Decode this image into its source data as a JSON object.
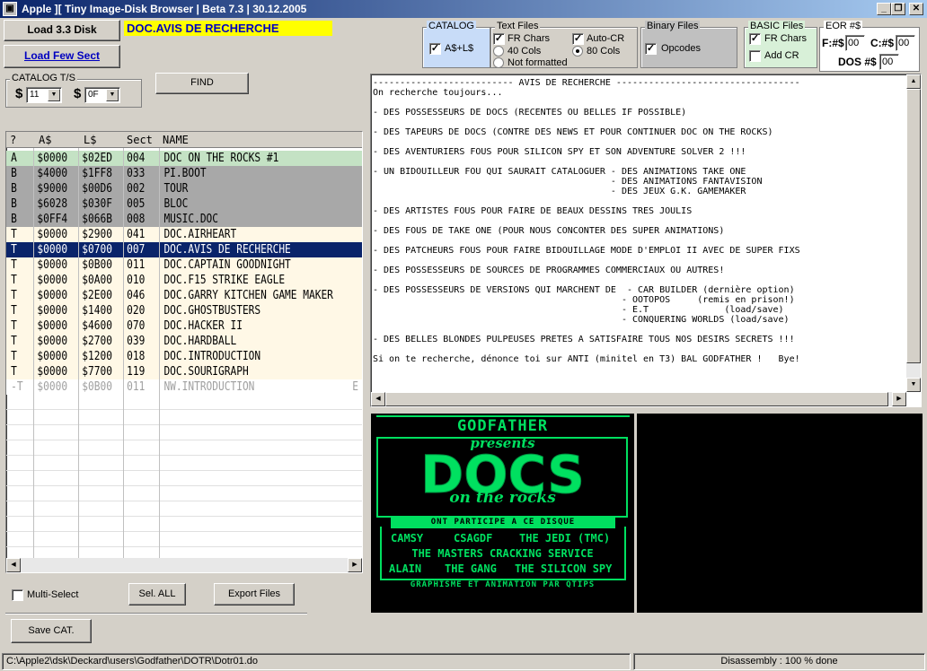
{
  "window": {
    "title": "Apple ][ Tiny Image-Disk Browser | Beta 7.3 | 30.12.2005",
    "controls": [
      "_",
      "❐",
      "✕"
    ]
  },
  "toolbar": {
    "load_disk": "Load 3.3 Disk",
    "load_few_sect": "Load Few Sect",
    "current_file": "DOC.AVIS DE RECHERCHE"
  },
  "catalog_group": {
    "label": "CATALOG",
    "option": "A$+L$",
    "checked": true
  },
  "text_files": {
    "label": "Text Files",
    "fr_chars": "FR Chars",
    "fr_chars_checked": true,
    "auto_cr": "Auto-CR",
    "auto_cr_checked": true,
    "cols40": "40 Cols",
    "cols80": "80 Cols",
    "cols_selected": "80",
    "not_formatted": "Not formatted"
  },
  "binary_files": {
    "label": "Binary Files",
    "opcodes": "Opcodes",
    "opcodes_checked": true
  },
  "basic_files": {
    "label": "BASIC Files",
    "fr_chars": "FR Chars",
    "fr_chars_checked": true,
    "add_cr": "Add CR",
    "add_cr_checked": false
  },
  "eor": {
    "label": "EOR #$",
    "f_label": "F:#$",
    "f_value": "00",
    "c_label": "C:#$",
    "c_value": "00",
    "dos_label": "DOS #$",
    "dos_value": "00"
  },
  "catalog_ts": {
    "label": "CATALOG T/S",
    "track_prefix": "$",
    "track": "11",
    "sector_prefix": "$",
    "sector": "0F"
  },
  "find_button": "FIND",
  "table": {
    "headers": [
      "?",
      "A$",
      "L$",
      "Sect",
      "NAME"
    ],
    "rows": [
      {
        "t": "A",
        "a": "$0000",
        "l": "$02ED",
        "s": "004",
        "n": "DOC ON THE ROCKS #1",
        "style": "a"
      },
      {
        "t": "B",
        "a": "$4000",
        "l": "$1FF8",
        "s": "033",
        "n": "PI.BOOT",
        "style": "b"
      },
      {
        "t": "B",
        "a": "$9000",
        "l": "$00D6",
        "s": "002",
        "n": "TOUR",
        "style": "b"
      },
      {
        "t": "B",
        "a": "$6028",
        "l": "$030F",
        "s": "005",
        "n": "BLOC",
        "style": "b"
      },
      {
        "t": "B",
        "a": "$0FF4",
        "l": "$066B",
        "s": "008",
        "n": "MUSIC.DOC",
        "style": "b"
      },
      {
        "t": "T",
        "a": "$0000",
        "l": "$2900",
        "s": "041",
        "n": "DOC.AIRHEART",
        "style": "t"
      },
      {
        "t": "T",
        "a": "$0000",
        "l": "$0700",
        "s": "007",
        "n": "DOC.AVIS DE RECHERCHE",
        "style": "sel"
      },
      {
        "t": "T",
        "a": "$0000",
        "l": "$0B00",
        "s": "011",
        "n": "DOC.CAPTAIN GOODNIGHT",
        "style": "t"
      },
      {
        "t": "T",
        "a": "$0000",
        "l": "$0A00",
        "s": "010",
        "n": "DOC.F15 STRIKE EAGLE",
        "style": "t"
      },
      {
        "t": "T",
        "a": "$0000",
        "l": "$2E00",
        "s": "046",
        "n": "DOC.GARRY KITCHEN GAME MAKER",
        "style": "t"
      },
      {
        "t": "T",
        "a": "$0000",
        "l": "$1400",
        "s": "020",
        "n": "DOC.GHOSTBUSTERS",
        "style": "t"
      },
      {
        "t": "T",
        "a": "$0000",
        "l": "$4600",
        "s": "070",
        "n": "DOC.HACKER II",
        "style": "t"
      },
      {
        "t": "T",
        "a": "$0000",
        "l": "$2700",
        "s": "039",
        "n": "DOC.HARDBALL",
        "style": "t"
      },
      {
        "t": "T",
        "a": "$0000",
        "l": "$1200",
        "s": "018",
        "n": "DOC.INTRODUCTION",
        "style": "t"
      },
      {
        "t": "T",
        "a": "$0000",
        "l": "$7700",
        "s": "119",
        "n": "DOC.SOURIGRAPH",
        "style": "t"
      },
      {
        "t": "-T",
        "a": "$0000",
        "l": "$0B00",
        "s": "011",
        "n": "NW.INTRODUCTION",
        "style": "del",
        "e": "E"
      }
    ]
  },
  "bottom": {
    "multi_select": "Multi-Select",
    "sel_all": "Sel. ALL",
    "export_files": "Export Files",
    "save_cat": "Save CAT."
  },
  "text_lines": [
    "-------------------------- AVIS DE RECHERCHE ----------------------------------",
    "On recherche toujours...",
    "",
    "- DES POSSESSEURS DE DOCS (RECENTES OU BELLES IF POSSIBLE)",
    "",
    "- DES TAPEURS DE DOCS (CONTRE DES NEWS ET POUR CONTINUER DOC ON THE ROCKS)",
    "",
    "- DES AVENTURIERS FOUS POUR SILICON SPY ET SON ADVENTURE SOLVER 2 !!!",
    "",
    "- UN BIDOUILLEUR FOU QUI SAURAIT CATALOGUER - DES ANIMATIONS TAKE ONE",
    "                                            - DES ANIMATIONS FANTAVISION",
    "                                            - DES JEUX G.K. GAMEMAKER",
    "",
    "- DES ARTISTES FOUS POUR FAIRE DE BEAUX DESSINS TRES JOULIS",
    "",
    "- DES FOUS DE TAKE ONE (POUR NOUS CONCONTER DES SUPER ANIMATIONS)",
    "",
    "- DES PATCHEURS FOUS POUR FAIRE BIDOUILLAGE MODE D'EMPLOI II AVEC DE SUPER FIXS",
    "",
    "- DES POSSESSEURS DE SOURCES DE PROGRAMMES COMMERCIAUX OU AUTRES!",
    "",
    "- DES POSSESSEURS DE VERSIONS QUI MARCHENT DE  - CAR BUILDER (dernière option)",
    "                                              - OOTOPOS     (remis en prison!)",
    "                                              - E.T              (load/save)",
    "                                              - CONQUERING WORLDS (load/save)",
    "",
    "- DES BELLES BLONDES PULPEUSES PRETES A SATISFAIRE TOUS NOS DESIRS SECRETS !!!",
    "",
    "Si on te recherche, dénonce toi sur ANTI (minitel en T3) BAL GODFATHER !   Bye!"
  ],
  "graphic": {
    "title1": "GODFATHER",
    "title2": "presents",
    "logo": "DOCS",
    "subtitle": "on the rocks",
    "banner": "ONT PARTICIPE A CE DISQUE",
    "credits": [
      [
        "CAMSY",
        "CSAGDF",
        "THE JEDI (TMC)"
      ],
      [
        "THE MASTERS CRACKING SERVICE"
      ],
      [
        "ALAIN",
        "THE GANG",
        "THE SILICON SPY"
      ]
    ],
    "footer": "GRAPHISME ET ANIMATION PAR QTIPS"
  },
  "status": {
    "path": "C:\\Apple2\\dsk\\Deckard\\users\\Godfather\\DOTR\\Dotr01.do",
    "right": "Disassembly : 100 % done"
  },
  "colors": {
    "row_a": "#c4e2c4",
    "row_b": "#a8a8a8",
    "row_t": "#fff8e6",
    "row_sel": "#0a246a",
    "graphic_green": "#00e060",
    "catalog_blue": "#c8dcf8",
    "basic_green": "#d8f0d8",
    "current_file_bg": "#ffff00"
  }
}
